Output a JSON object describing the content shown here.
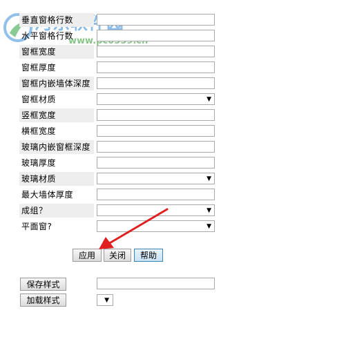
{
  "watermark": {
    "title": "河东软件园",
    "url": "www.pc0359.cn"
  },
  "form": {
    "rows": [
      {
        "label": "垂直窗格行数",
        "type": "text",
        "value": ""
      },
      {
        "label": "水平窗格行数",
        "type": "text",
        "value": ""
      },
      {
        "label": "窗框宽度",
        "type": "text",
        "value": ""
      },
      {
        "label": "窗框厚度",
        "type": "text",
        "value": ""
      },
      {
        "label": "窗框内嵌墙体深度",
        "type": "text",
        "value": ""
      },
      {
        "label": "窗框材质",
        "type": "select",
        "value": ""
      },
      {
        "label": "竖框宽度",
        "type": "text",
        "value": ""
      },
      {
        "label": "横框宽度",
        "type": "text",
        "value": ""
      },
      {
        "label": "玻璃内嵌窗框深度",
        "type": "text",
        "value": ""
      },
      {
        "label": "玻璃厚度",
        "type": "text",
        "value": ""
      },
      {
        "label": "玻璃材质",
        "type": "select",
        "value": ""
      },
      {
        "label": "最大墙体厚度",
        "type": "text",
        "value": ""
      },
      {
        "label": "成组？",
        "type": "select",
        "value": ""
      },
      {
        "label": "平面窗?",
        "type": "select",
        "value": ""
      }
    ]
  },
  "actions": {
    "apply": "应用",
    "close": "关闭",
    "help": "帮助"
  },
  "style_section": {
    "save_label": "保存样式",
    "load_label": "加载样式",
    "save_name_value": ""
  },
  "colors": {
    "arrow": "#e02020",
    "row_shade": "#eeeeee"
  }
}
